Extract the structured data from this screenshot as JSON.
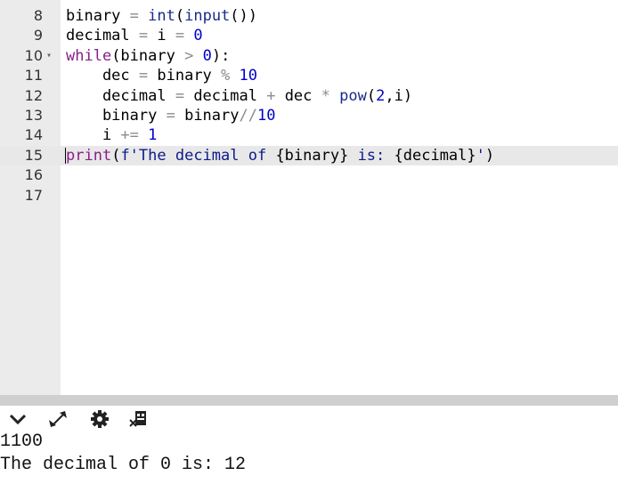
{
  "editor": {
    "lines": [
      {
        "num": "8",
        "tokens": [
          [
            "binary",
            ""
          ],
          [
            " = ",
            "op"
          ],
          [
            "int",
            "fn"
          ],
          [
            "(",
            ""
          ],
          [
            "input",
            "fn"
          ],
          [
            "())",
            ""
          ]
        ]
      },
      {
        "num": "9",
        "tokens": [
          [
            "decimal",
            ""
          ],
          [
            " = ",
            "op"
          ],
          [
            "i",
            ""
          ],
          [
            " = ",
            "op"
          ],
          [
            "0",
            "num"
          ]
        ]
      },
      {
        "num": "10",
        "fold": "▾",
        "tokens": [
          [
            "while",
            "kw"
          ],
          [
            "(binary ",
            ""
          ],
          [
            ">",
            "op"
          ],
          [
            " ",
            ""
          ],
          [
            "0",
            "num"
          ],
          [
            "):",
            ""
          ]
        ]
      },
      {
        "num": "11",
        "tokens": [
          [
            "    dec ",
            ""
          ],
          [
            "=",
            "op"
          ],
          [
            " binary ",
            ""
          ],
          [
            "%",
            "op"
          ],
          [
            " ",
            ""
          ],
          [
            "10",
            "num"
          ]
        ]
      },
      {
        "num": "12",
        "tokens": [
          [
            "    decimal ",
            ""
          ],
          [
            "=",
            "op"
          ],
          [
            " decimal ",
            ""
          ],
          [
            "+",
            "op"
          ],
          [
            " dec ",
            ""
          ],
          [
            "*",
            "op"
          ],
          [
            " ",
            ""
          ],
          [
            "pow",
            "fn"
          ],
          [
            "(",
            ""
          ],
          [
            "2",
            "num"
          ],
          [
            ",i)",
            ""
          ]
        ]
      },
      {
        "num": "13",
        "tokens": [
          [
            "    binary ",
            ""
          ],
          [
            "=",
            "op"
          ],
          [
            " binary",
            ""
          ],
          [
            "//",
            "op"
          ],
          [
            "10",
            "num"
          ]
        ]
      },
      {
        "num": "14",
        "tokens": [
          [
            "    i ",
            ""
          ],
          [
            "+=",
            "op"
          ],
          [
            " ",
            ""
          ],
          [
            "1",
            "num"
          ]
        ]
      },
      {
        "num": "15",
        "active": true,
        "tokens": [
          [
            "print",
            "kw"
          ],
          [
            "(",
            ""
          ],
          [
            "f'The decimal of ",
            "str"
          ],
          [
            "{binary}",
            ""
          ],
          [
            " is: ",
            "str"
          ],
          [
            "{decimal}",
            ""
          ],
          [
            "'",
            "str"
          ],
          [
            ")",
            ""
          ]
        ]
      },
      {
        "num": "16",
        "tokens": []
      },
      {
        "num": "17",
        "tokens": []
      }
    ]
  },
  "console": {
    "toolbar": [
      {
        "name": "collapse-chevron-icon",
        "glyph": "chevron"
      },
      {
        "name": "expand-arrows-icon",
        "glyph": "expand"
      },
      {
        "name": "settings-gear-icon",
        "glyph": "gear"
      },
      {
        "name": "clear-console-icon",
        "glyph": "clear"
      }
    ],
    "output": [
      "1100",
      "The decimal of 0 is: 12"
    ]
  }
}
